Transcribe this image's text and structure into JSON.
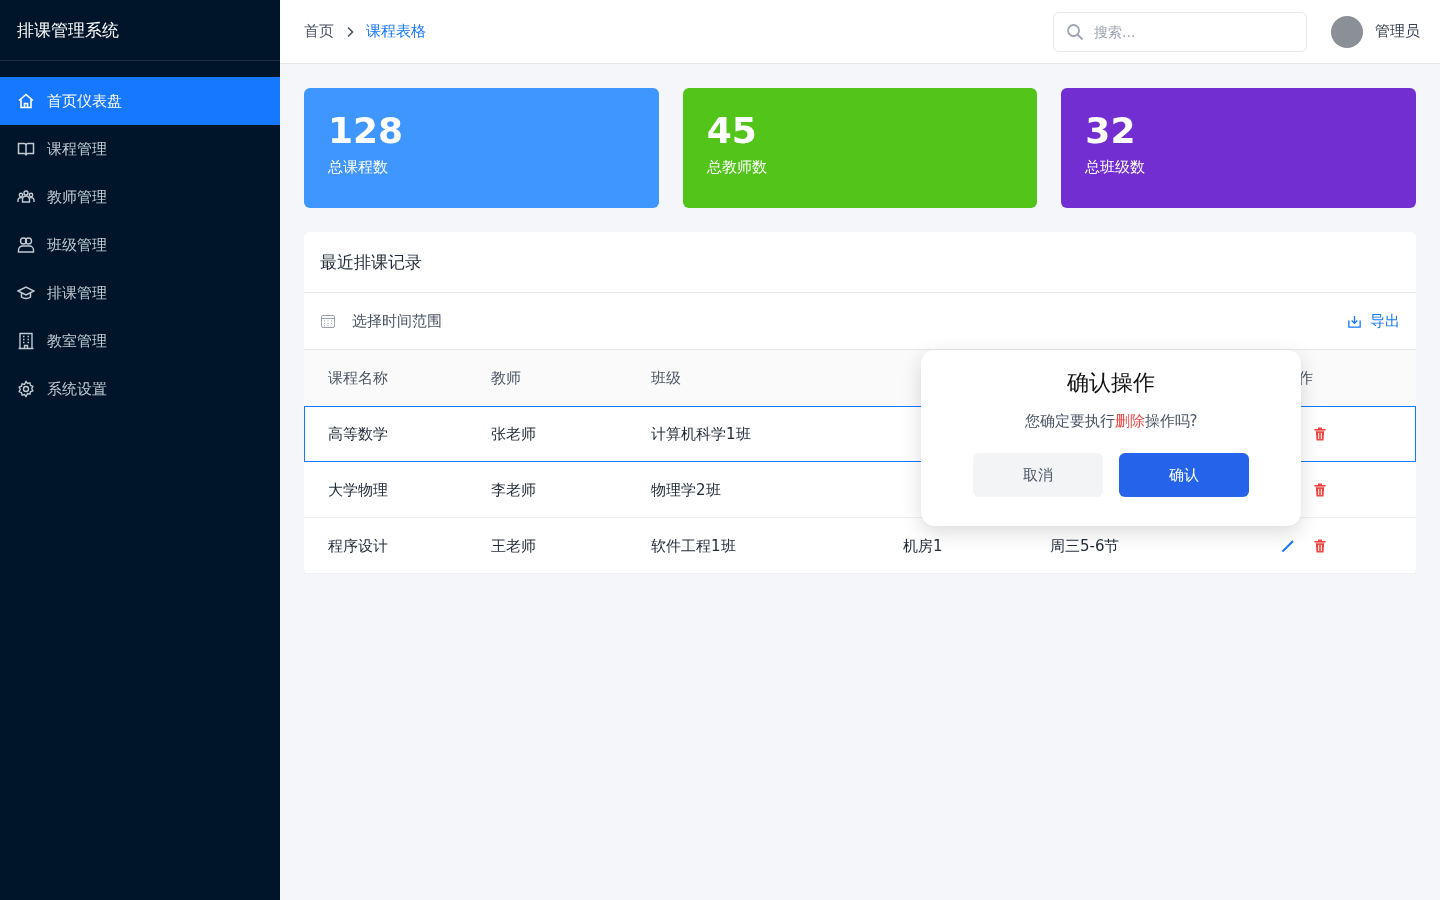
{
  "sidebar": {
    "title": "排课管理系统",
    "items": [
      {
        "label": "首页仪表盘",
        "kind": "home",
        "selected": true
      },
      {
        "label": "课程管理",
        "kind": "book",
        "selected": false
      },
      {
        "label": "教师管理",
        "kind": "users",
        "selected": false
      },
      {
        "label": "班级管理",
        "kind": "group",
        "selected": false
      },
      {
        "label": "排课管理",
        "kind": "cap",
        "selected": false
      },
      {
        "label": "教室管理",
        "kind": "building",
        "selected": false
      },
      {
        "label": "系统设置",
        "kind": "gear",
        "selected": false
      }
    ]
  },
  "header": {
    "breadcrumb": [
      {
        "label": "首页",
        "selected": false
      },
      {
        "label": "课程表格",
        "selected": true
      }
    ],
    "search": {
      "placeholder": "搜索..."
    },
    "user": "管理员"
  },
  "stats": [
    {
      "value": "128",
      "label": "总课程数",
      "color": "#4096ff"
    },
    {
      "value": "45",
      "label": "总教师数",
      "color": "#52c41a"
    },
    {
      "value": "32",
      "label": "总班级数",
      "color": "#722ed1"
    }
  ],
  "table": {
    "title": "最近排课记录",
    "date_filter": "选择时间范围",
    "export": "导出",
    "columns": [
      "课程名称",
      "教师",
      "班级",
      "作"
    ],
    "rows": [
      {
        "course": "高等数学",
        "teacher": "张老师",
        "class": "计算机科学1班",
        "selected": true,
        "actions": [
          {
            "kind": "delete"
          }
        ]
      },
      {
        "course": "大学物理",
        "teacher": "李老师",
        "class": "物理学2班",
        "selected": false,
        "actions": [
          {
            "kind": "delete"
          }
        ]
      },
      {
        "course": "程序设计",
        "teacher": "王老师",
        "class": "软件工程1班",
        "room": "机房1",
        "time": "周三5-6节",
        "selected": false,
        "actions": [
          {
            "kind": "edit"
          },
          {
            "kind": "delete"
          }
        ]
      }
    ]
  },
  "dialog": {
    "title": "确认操作",
    "message_before": "您确定要执行",
    "message_highlight": "删除",
    "message_after": "操作吗?",
    "buttons": [
      {
        "label": "取消",
        "kind": "cancel"
      },
      {
        "label": "确认",
        "kind": "confirm"
      }
    ]
  }
}
